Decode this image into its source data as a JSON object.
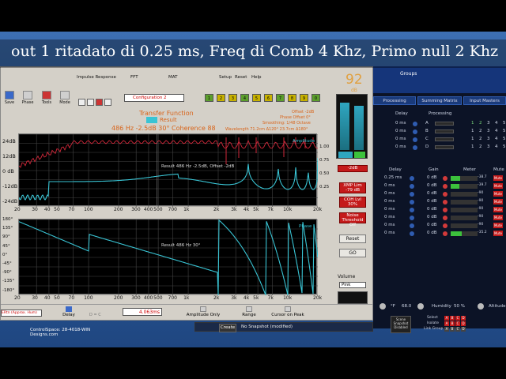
{
  "caption": "out 1 ritadato di 0.25 ms, Freq di Comb 4 Khz, Primo null 2 Khz",
  "desktop": {
    "bottom_label_line1": "ControlSpace: 28-4018-WIN",
    "bottom_label_line2": "Designs.com"
  },
  "smaart": {
    "menu": {
      "impulse": "Impulse Response",
      "fft": "FFT",
      "mat": "MAT",
      "setup": "Setup",
      "reset": "Reset",
      "help": "Help"
    },
    "toolbar": {
      "save": "Save",
      "phase": "Phase",
      "tools": "Tools",
      "mode": "Mode",
      "config": "Configuration 2",
      "num_buttons": [
        "1",
        "2",
        "3",
        "4",
        "5",
        "6",
        "7",
        "8",
        "9",
        "0"
      ]
    },
    "header": {
      "title": "Transfer Function",
      "result": "Result",
      "info": "486 Hz -2.5dB  30°  Coherence  88",
      "offset": "Offset -2dB",
      "phase_offset": "Phase Offset 0°",
      "smoothing": "Smoothing: 1/48 Octave",
      "wavelength": "Wavelength 71.2cm  Δ120° 23.7cm  Δ180°",
      "big_value": "92",
      "big_unit": "dB"
    },
    "mag_plot": {
      "label_amp": "Amplitude",
      "result_text": "Result 486 Hz -2.5dB, Offset -2dB",
      "y_ticks": [
        "24dB",
        "12dB",
        "0 dB",
        "-12dB",
        "-24dB"
      ],
      "coh_ticks": [
        "1.00",
        "0.75",
        "0.50",
        "0.25"
      ]
    },
    "phase_plot": {
      "label": "Phase",
      "result_text": "Result 486 Hz 30°",
      "y_ticks": [
        "180°",
        "135°",
        "90°",
        "45°",
        "0°",
        "-45°",
        "-90°",
        "-135°",
        "-180°"
      ]
    },
    "x_ticks": [
      "20",
      "30",
      "40",
      "50",
      "70",
      "100",
      "200",
      "300",
      "400",
      "500",
      "700",
      "1k",
      "2k",
      "3k",
      "4k",
      "5k",
      "7k",
      "10k",
      "20k"
    ],
    "side": {
      "gain_btn": "-2dB",
      "mic_btn": "XMP Lim",
      "mic_val": "-79 dB",
      "coh_btn": "COH Lvl",
      "coh_val": "30%",
      "noise_btn": "Noise Threshold",
      "noise_val": "Off",
      "reset": "Reset",
      "go": "GO",
      "volume": "Volume",
      "pink": "Pink"
    },
    "bottom": {
      "input": "ERtn (Approx. Hum)",
      "delay": "Delay",
      "dmc": "D = C",
      "delay_value": "4.063ms",
      "amp_only": "Amplitude Only",
      "range": "Range",
      "cursor": "Cursor on Peak"
    }
  },
  "snapshot": {
    "create": "Create",
    "status": "No Snapshot (modified)"
  },
  "console": {
    "title": "Groups",
    "tabs": [
      "Processing",
      "Summing Matrix",
      "Input Masters"
    ],
    "proc_header": {
      "delay": "Delay",
      "processing": "Processing"
    },
    "top_rows": [
      {
        "val": "0 ms",
        "ch": "A"
      },
      {
        "val": "0 ms",
        "ch": "B"
      },
      {
        "val": "0 ms",
        "ch": "C"
      },
      {
        "val": "0 ms",
        "ch": "D"
      }
    ],
    "matrix_nums": [
      "1",
      "2",
      "3",
      "4",
      "5"
    ],
    "out_header": {
      "delay": "Delay",
      "gain": "Gain",
      "meter": "Meter",
      "mute": "Mute"
    },
    "out_rows": [
      {
        "delay": "0.25 ms",
        "gain": "0 dB",
        "meter": "-38.7",
        "level": 0.35
      },
      {
        "delay": "0 ms",
        "gain": "0 dB",
        "meter": "-39.7",
        "level": 0.33
      },
      {
        "delay": "0 ms",
        "gain": "0 dB",
        "meter": "-90",
        "level": 0.0
      },
      {
        "delay": "0 ms",
        "gain": "0 dB",
        "meter": "-90",
        "level": 0.0
      },
      {
        "delay": "0 ms",
        "gain": "0 dB",
        "meter": "-90",
        "level": 0.0
      },
      {
        "delay": "0 ms",
        "gain": "0 dB",
        "meter": "-90",
        "level": 0.0
      },
      {
        "delay": "0 ms",
        "gain": "0 dB",
        "meter": "-90",
        "level": 0.0
      },
      {
        "delay": "0 ms",
        "gain": "0 dB",
        "meter": "-35.2",
        "level": 0.4
      }
    ],
    "mute_label": "Mute",
    "temp": "68.0",
    "temp_unit": "°F",
    "humidity_label": "Humidity",
    "humidity": "50 %",
    "altitude_label": "Altitude",
    "snapshot_btn": "Scene Snapshot Disabled",
    "select": "Select",
    "isolate": "Isolate",
    "link_group": "Link Group",
    "letters": [
      "A",
      "B",
      "C",
      "D"
    ],
    "colors": {
      "accent": "#2f5cb1",
      "meter_green": "#3cc23c",
      "mute_red": "#c41a1a"
    }
  },
  "trace_colors": {
    "magnitude": "#39c4d4",
    "coherence": "#d0283a",
    "axis_orange": "#e8781a"
  }
}
